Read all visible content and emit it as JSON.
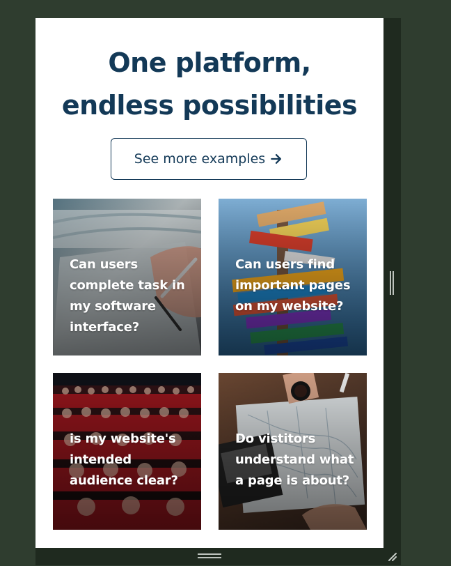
{
  "hero": {
    "headline_line1": "One platform,",
    "headline_line2": "endless possibilities"
  },
  "cta": {
    "label": "See more examples",
    "icon": "arrow-right-icon"
  },
  "cards": [
    {
      "text": "Can users complete task in my software interface?"
    },
    {
      "text": "Can users find important pages on my website?"
    },
    {
      "text": "is my website's intended audience clear?"
    },
    {
      "text": "Do vistitors understand what a page is about?"
    }
  ],
  "colors": {
    "page_bg": "#2f3d2f",
    "content_bg": "#ffffff",
    "primary": "#133957",
    "card_text": "#ffffff"
  }
}
